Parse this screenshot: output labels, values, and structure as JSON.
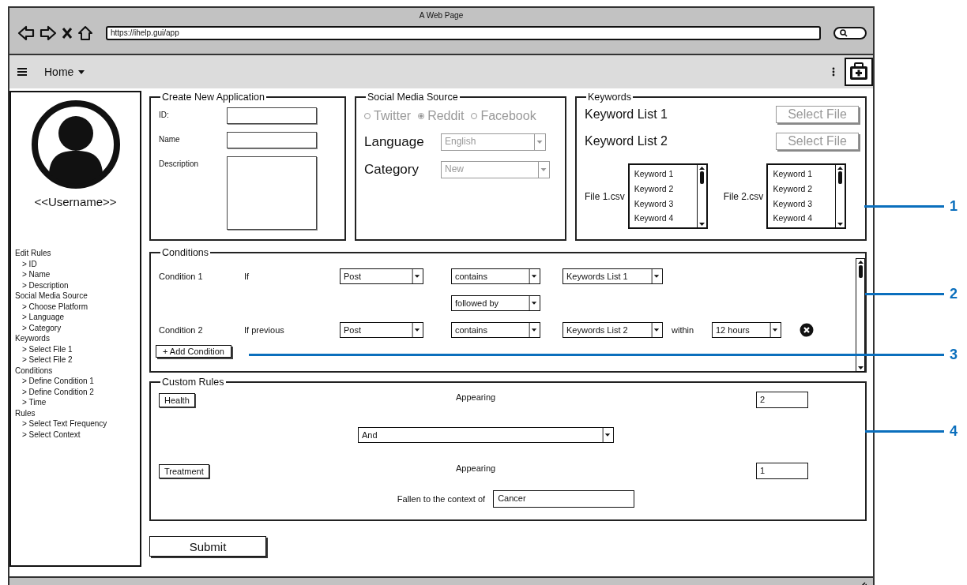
{
  "browser": {
    "title": "A Web Page",
    "url": "https://ihelp.gui/app"
  },
  "nav": {
    "menu": "Home"
  },
  "sidebar": {
    "username": "<<Username>>",
    "outline": [
      {
        "label": "Edit Rules",
        "children": [
          {
            "label": "> ID"
          },
          {
            "label": "> Name"
          },
          {
            "label": "> Description"
          }
        ]
      },
      {
        "label": "Social Media Source",
        "children": [
          {
            "label": "> Choose Platform"
          },
          {
            "label": "> Language"
          },
          {
            "label": "> Category"
          }
        ]
      },
      {
        "label": "Keywords",
        "children": [
          {
            "label": "> Select File 1"
          },
          {
            "label": "> Select File 2"
          }
        ]
      },
      {
        "label": "Conditions",
        "children": [
          {
            "label": "> Define Condition 1"
          },
          {
            "label": "> Define Condition 2"
          },
          {
            "label": "> Time"
          }
        ]
      },
      {
        "label": "Rules",
        "children": [
          {
            "label": "> Select Text Frequency"
          },
          {
            "label": "> Select Context"
          }
        ]
      }
    ]
  },
  "create_application": {
    "title": "Create New Application",
    "fields": [
      {
        "label": "ID:",
        "kind": "input"
      },
      {
        "label": "Name",
        "kind": "input"
      },
      {
        "label": "Description",
        "kind": "textarea"
      }
    ]
  },
  "social_media_source": {
    "title": "Social Media Source",
    "disabled": true,
    "platforms": [
      {
        "label": "Twitter",
        "selected": false
      },
      {
        "label": "Reddit",
        "selected": true
      },
      {
        "label": "Facebook",
        "selected": false
      }
    ],
    "selects": [
      {
        "label": "Language",
        "value": "English"
      },
      {
        "label": "Category",
        "value": "New"
      }
    ]
  },
  "keywords": {
    "title": "Keywords",
    "lists": [
      {
        "label": "Keyword List 1",
        "button": {
          "label": "Select File",
          "disabled": true
        },
        "file": "File 1.csv",
        "items": [
          "Keyword 1",
          "Keyword 2",
          "Keyword 3",
          "Keyword 4"
        ]
      },
      {
        "label": "Keyword List 2",
        "button": {
          "label": "Select File",
          "disabled": true
        },
        "file": "File 2.csv",
        "items": [
          "Keyword 1",
          "Keyword 2",
          "Keyword 3",
          "Keyword 4"
        ]
      }
    ]
  },
  "conditions": {
    "title": "Conditions",
    "rows": [
      {
        "kind": "condition",
        "label": "Condition 1",
        "prefix": "If",
        "source": "Post",
        "operator": "contains",
        "keywords": "Keywords List 1"
      },
      {
        "kind": "joiner",
        "operator": "followed by"
      },
      {
        "kind": "condition",
        "label": "Condition 2",
        "prefix": "If previous",
        "source": "Post",
        "operator": "contains",
        "keywords": "Keywords List 2",
        "within": "within",
        "time": "12 hours",
        "removable": true
      }
    ],
    "add_button": "+ Add Condition"
  },
  "custom_rules": {
    "title": "Custom Rules",
    "rows": [
      {
        "kind": "term",
        "term": "Health",
        "label": "Appearing",
        "count": "2"
      },
      {
        "kind": "operator",
        "value": "And"
      },
      {
        "kind": "term",
        "term": "Treatment",
        "label": "Appearing",
        "count": "1"
      },
      {
        "kind": "context",
        "label": "Fallen to the context of",
        "value": "Cancer"
      }
    ]
  },
  "submit": "Submit",
  "callouts": [
    "1",
    "2",
    "3",
    "4"
  ]
}
